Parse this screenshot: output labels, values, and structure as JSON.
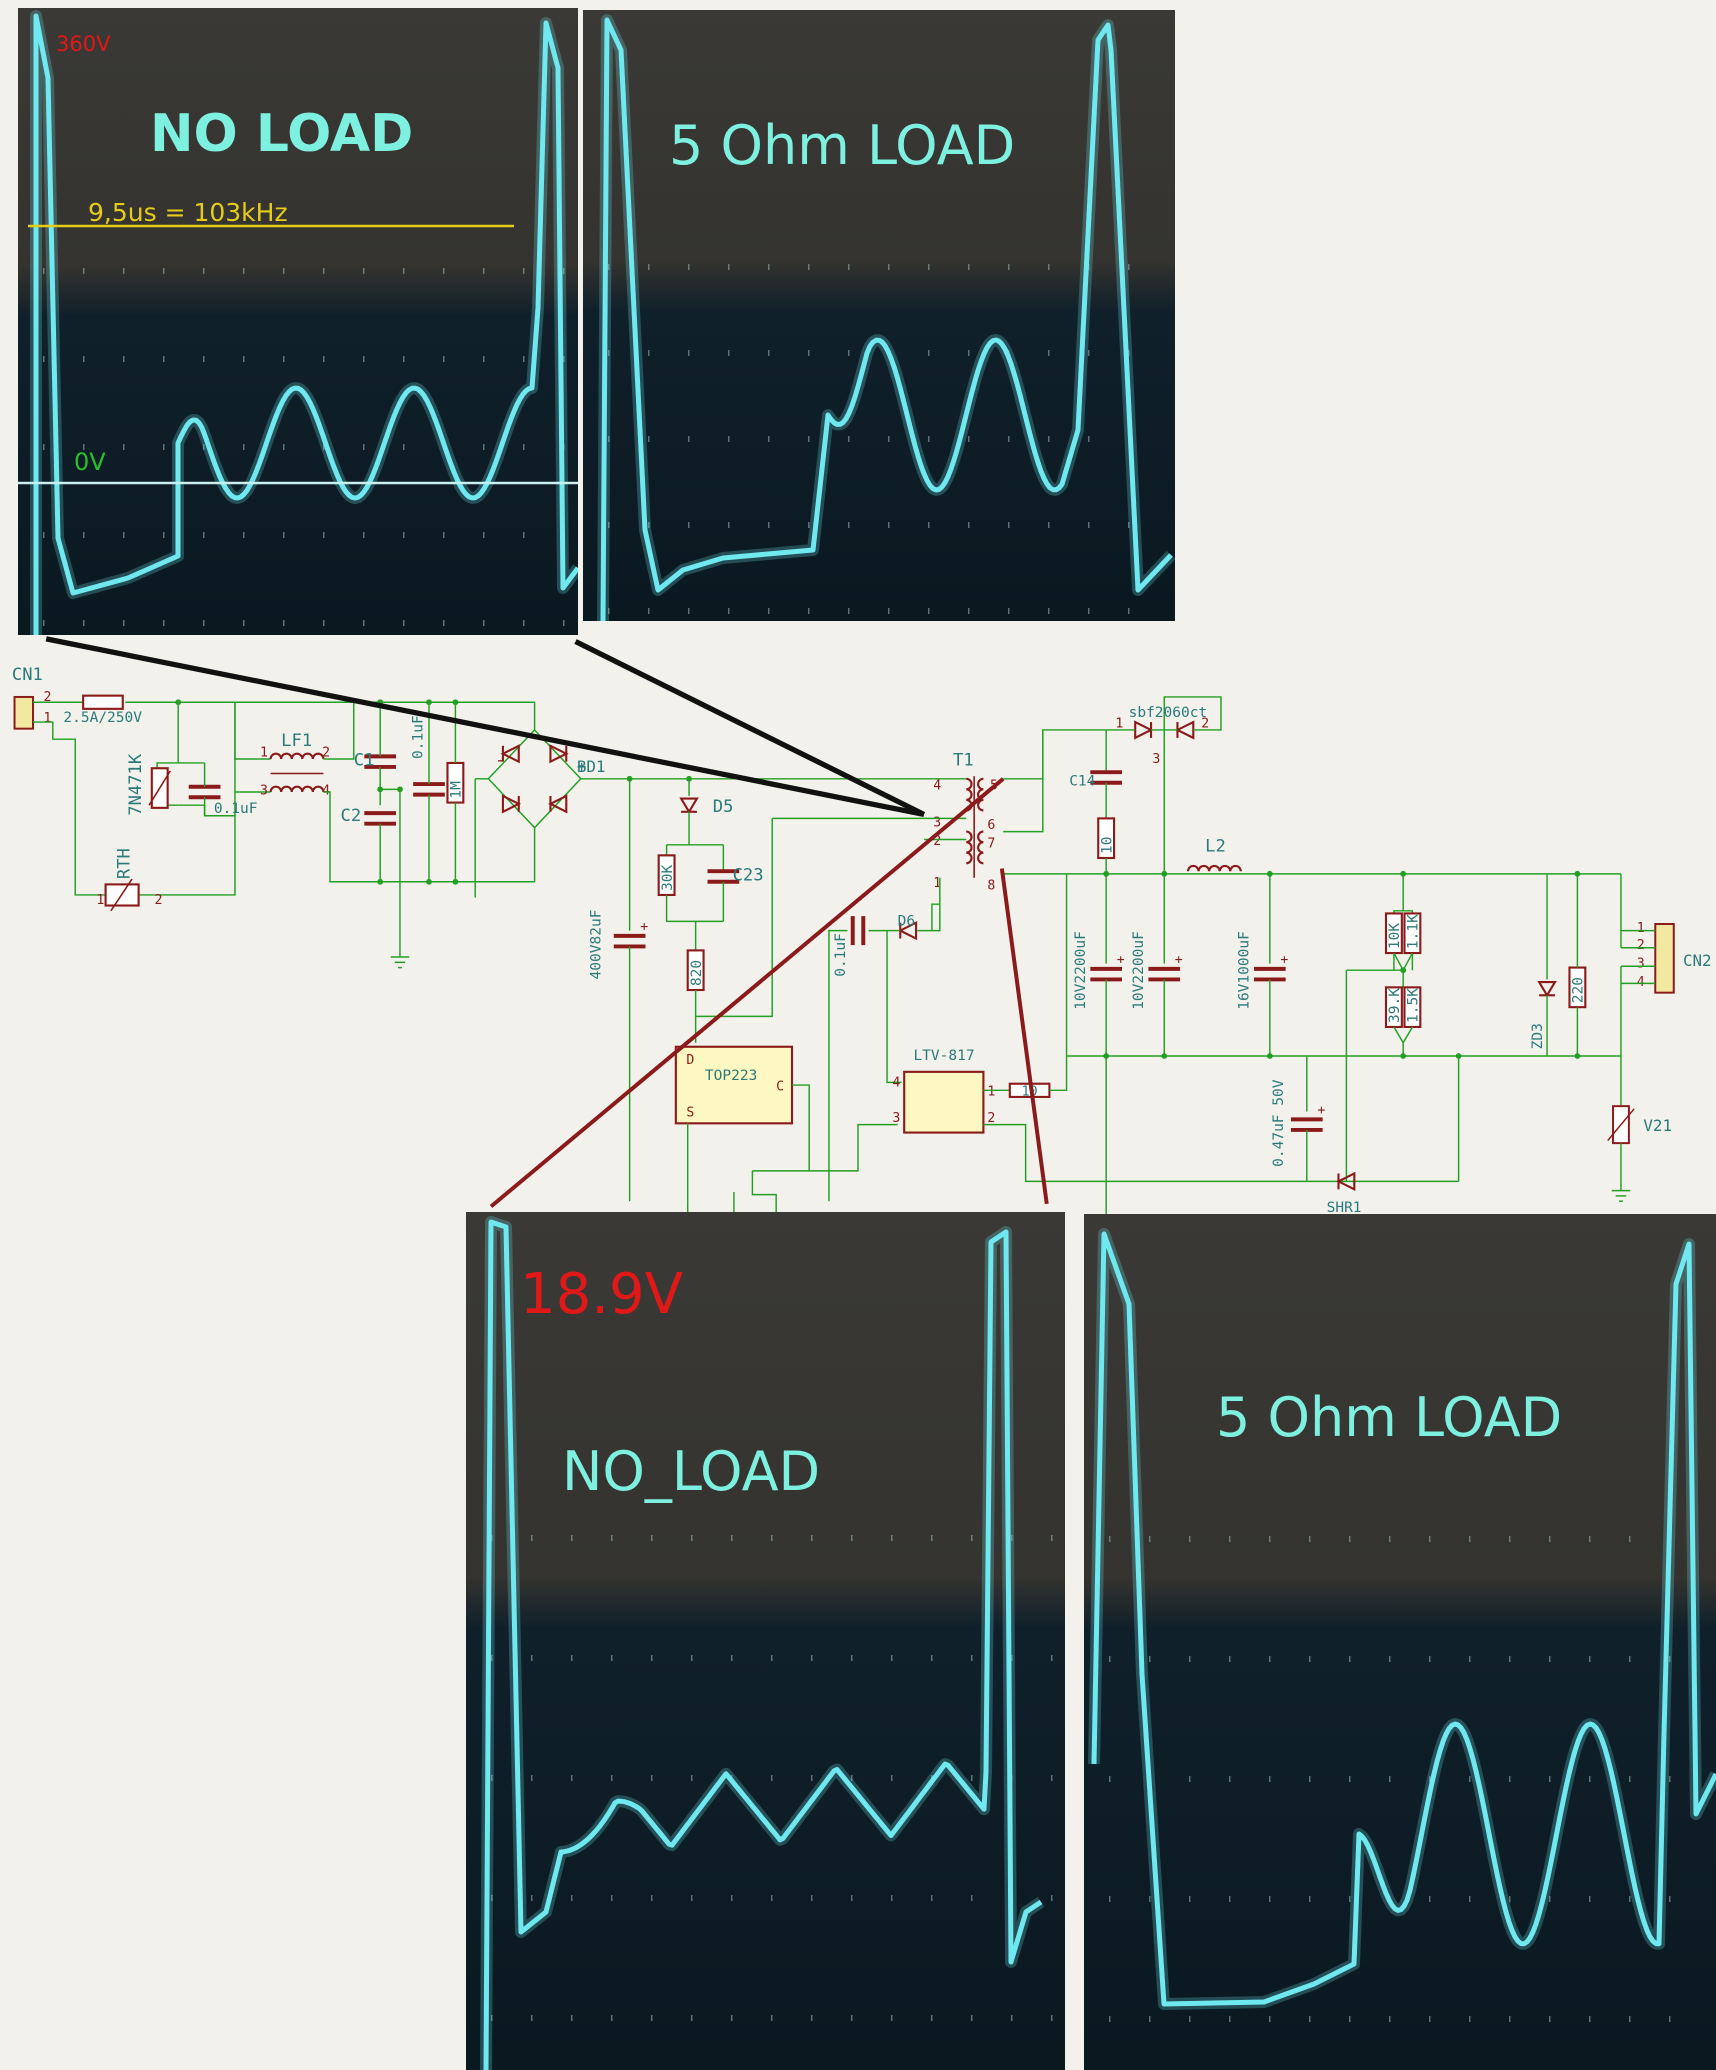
{
  "colors": {
    "page_bg": "#f2f1ec",
    "scope_bg_top": "#3a3936",
    "scope_bg_bottom": "#10202a",
    "trace": "#6fe8f0",
    "wire": "#23a023",
    "component": "#8b1a1a",
    "ref_text": "#2a7a7a",
    "label_red": "#e01818",
    "label_cyan": "#7ef0e0",
    "label_yellow": "#e6cc1a",
    "label_green": "#2ac02a"
  },
  "scopes": {
    "primary_no_load": {
      "title": "NO LOAD",
      "voltage_label": "360V",
      "period_label": "9,5us = 103kHz",
      "zero_label": "0V"
    },
    "primary_5ohm": {
      "title": "5 Ohm LOAD"
    },
    "secondary_no_load": {
      "title": "NO_LOAD",
      "voltage_label": "18.9V"
    },
    "secondary_5ohm": {
      "title": "5 Ohm LOAD"
    }
  },
  "schematic": {
    "cn1": "CN1",
    "fuse": "2.5A/250V",
    "varistor": "7N471K",
    "c_x1": "0.1uF",
    "lf1": "LF1",
    "c1": "C1",
    "c2": "C2",
    "c_y": "0.1uF",
    "r_bleed": "1M",
    "rth": "RTH",
    "bd1": "BD1",
    "c_bulk": "400V82uF",
    "d5": "D5",
    "r30k": "30K",
    "c23": "C23",
    "r820": "820",
    "top": "TOP223",
    "top_d": "D",
    "top_s": "S",
    "top_c": "C",
    "t1": "T1",
    "d6": "D6",
    "c_bias": "0.1uF",
    "ltv": "LTV-817",
    "r10_opto": "10",
    "c14": "C14",
    "r10_snub": "10",
    "diode_out": "sbf2060ct",
    "l2": "L2",
    "c_out1": "10V2200uF",
    "c_out2": "10V2200uF",
    "c_out3": "16V1000uF",
    "r10k": "10K",
    "r1k1": "1.1K",
    "r39k": "39.K",
    "r1k5": "1.5K",
    "zd3": "ZD3",
    "r220": "220",
    "cn2": "CN2",
    "v21": "V21",
    "c_comp": "0.47uF 50V",
    "shr": "SHR1",
    "pins": {
      "p1": "1",
      "p2": "2",
      "p3": "3",
      "p4": "4",
      "p5": "5",
      "p6": "6",
      "p7": "7",
      "p8": "8",
      "plus": "+",
      "minus": "-"
    }
  }
}
